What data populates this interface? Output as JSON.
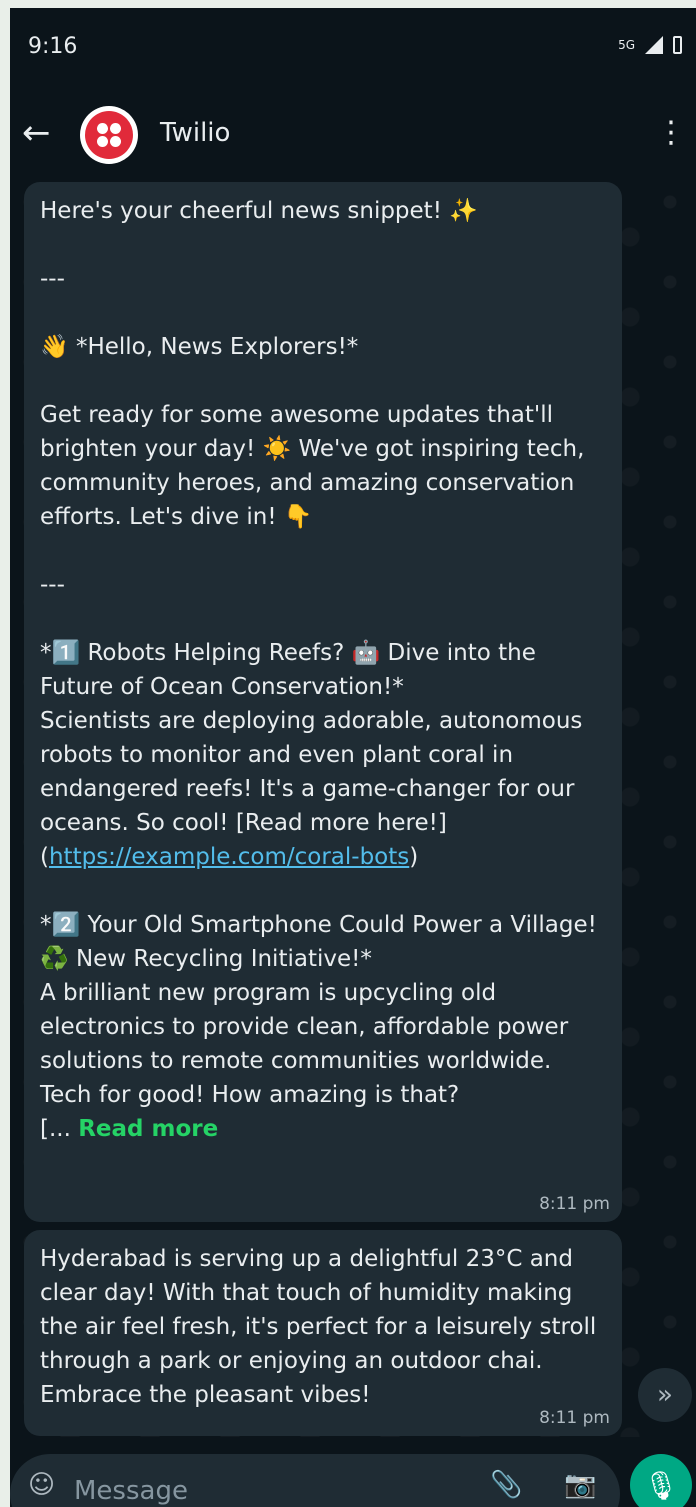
{
  "status_bar": {
    "time": "9:16",
    "network": "5G"
  },
  "header": {
    "contact_name": "Twilio"
  },
  "messages": [
    {
      "text_a": "Here's your cheerful news snippet! ✨\n\n---\n\n👋 *Hello, News Explorers!*\n\nGet ready for some awesome updates that'll brighten your day! ☀️ We've got inspiring tech, community heroes, and amazing conservation efforts. Let's dive in! 👇\n\n---\n\n*1️⃣ Robots Helping Reefs? 🤖 Dive into the Future of Ocean Conservation!*\nScientists are deploying adorable, autonomous robots to monitor and even plant coral in endangered reefs! It's a game-changer for our oceans. So cool! [Read more here!](",
      "link": "https://example.com/coral-bots",
      "text_b": ")\n\n*2️⃣ Your Old Smartphone Could Power a Village! ♻️ New Recycling Initiative!*\nA brilliant new program is upcycling old electronics to provide clean, affordable power solutions to remote communities worldwide. Tech for good! How amazing is that?\n[... ",
      "read_more": "Read more",
      "time": "8:11 pm"
    },
    {
      "text": "Hyderabad is serving up a delightful 23°C and clear day! With that touch of humidity making the air feel fresh, it's perfect for a leisurely stroll through a park or enjoying an outdoor chai. Embrace the pleasant vibes!",
      "time": "8:11 pm"
    }
  ],
  "composer": {
    "placeholder": "Message"
  },
  "icons": {
    "back": "arrow-left-icon",
    "menu": "more-vert-icon",
    "scroll": "chevron-double-down-icon",
    "emoji": "emoji-icon",
    "attach": "paperclip-icon",
    "camera": "camera-icon",
    "mic": "mic-icon"
  },
  "colors": {
    "accent": "#00a884",
    "link": "#53bdeb",
    "read_more": "#25d366",
    "bubble": "#1f2c34",
    "background": "#0b141a"
  }
}
